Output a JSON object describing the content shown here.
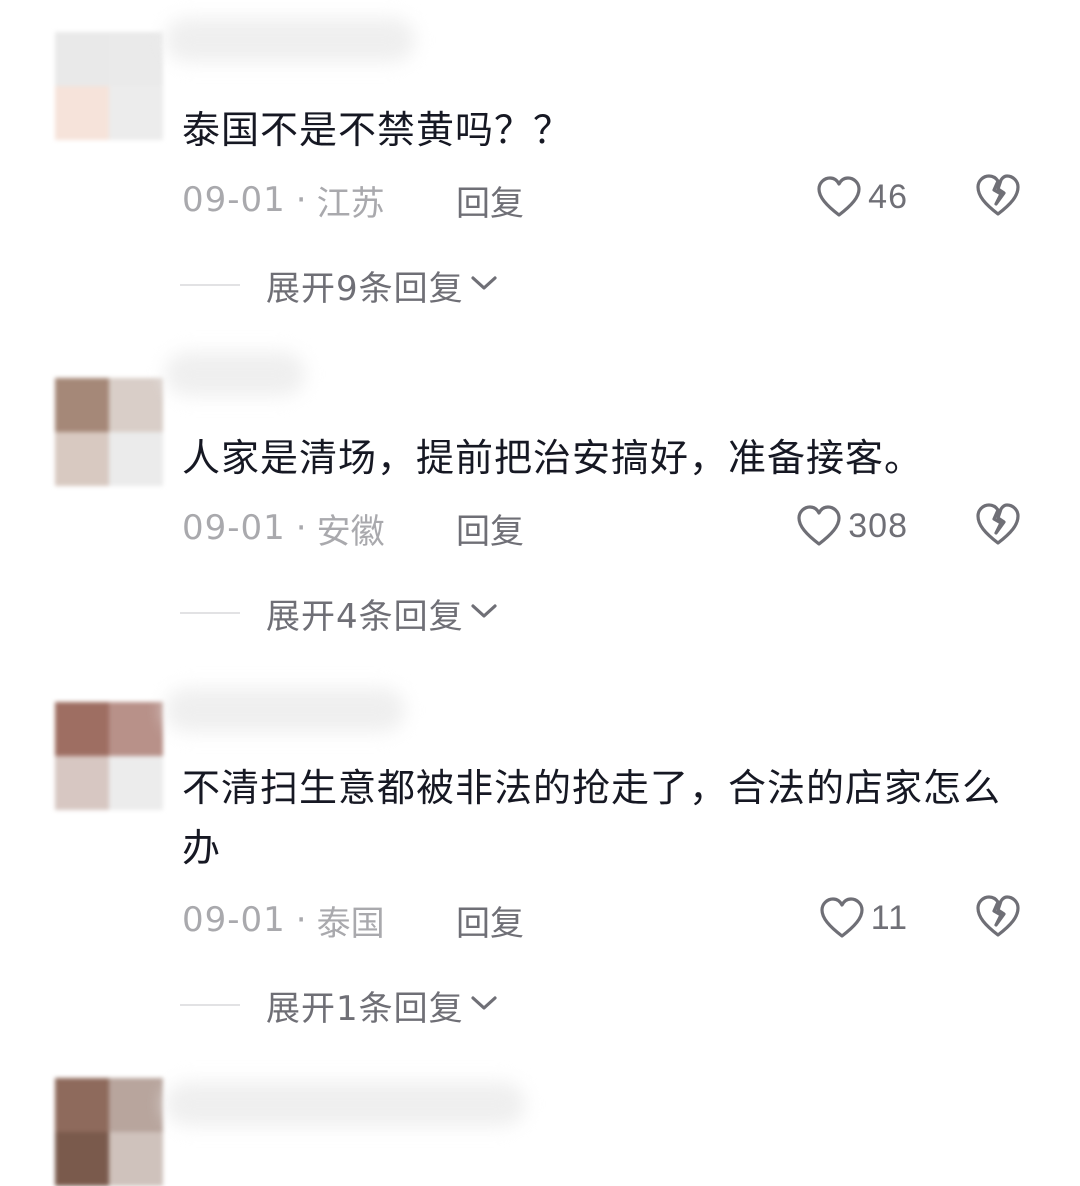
{
  "comments": [
    {
      "text": "泰国不是不禁黄吗？？",
      "date": "09-01",
      "location": "江苏",
      "reply_label": "回复",
      "likes": "46",
      "expand_label": "展开9条回复"
    },
    {
      "text": "人家是清场，提前把治安搞好，准备接客。",
      "date": "09-01",
      "location": "安徽",
      "reply_label": "回复",
      "likes": "308",
      "expand_label": "展开4条回复"
    },
    {
      "text": "不清扫生意都被非法的抢走了，合法的店家怎么办",
      "date": "09-01",
      "location": "泰国",
      "reply_label": "回复",
      "likes": "11",
      "expand_label": "展开1条回复"
    }
  ],
  "separator": "·",
  "icons": {
    "like": "heart-outline-icon",
    "dislike": "broken-heart-icon",
    "expand": "chevron-down-icon"
  },
  "colors": {
    "text": "#161823",
    "meta": "#a9a9ad",
    "secondary": "#6f6f76"
  }
}
